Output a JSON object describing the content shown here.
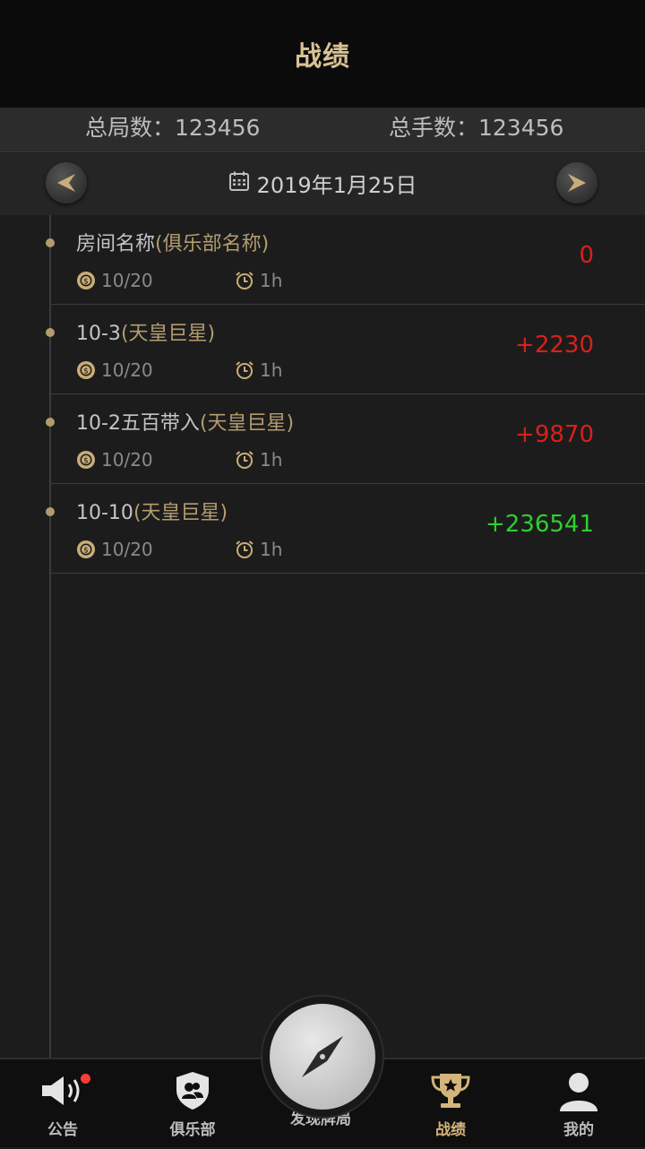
{
  "header": {
    "title": "战绩"
  },
  "stats": {
    "total_rounds": "总局数：123456",
    "total_hands": "总手数：123456"
  },
  "date_bar": {
    "date": "2019年1月25日"
  },
  "records": [
    {
      "room": "房间名称",
      "club": "(俱乐部名称)",
      "blinds": "10/20",
      "duration": "1h",
      "score": "0",
      "score_color": "#d9201a"
    },
    {
      "room": "10-3",
      "club": "(天皇巨星)",
      "blinds": "10/20",
      "duration": "1h",
      "score": "+2230",
      "score_color": "#d9201a"
    },
    {
      "room": "10-2五百带入",
      "club": "(天皇巨星)",
      "blinds": "10/20",
      "duration": "1h",
      "score": "+9870",
      "score_color": "#d9201a"
    },
    {
      "room": "10-10",
      "club": "(天皇巨星)",
      "blinds": "10/20",
      "duration": "1h",
      "score": "+236541",
      "score_color": "#2fcf2f"
    }
  ],
  "tabbar": {
    "items": [
      {
        "label": "公告",
        "icon": "speaker-icon",
        "has_badge": true
      },
      {
        "label": "俱乐部",
        "icon": "club-shield-icon"
      },
      {
        "label": "发现牌局",
        "icon": "compass-icon"
      },
      {
        "label": "战绩",
        "icon": "trophy-icon",
        "active": true
      },
      {
        "label": "我的",
        "icon": "user-icon"
      }
    ]
  },
  "colors": {
    "accent": "#d3b47a",
    "negative_or_zero": "#d9201a",
    "positive_large": "#2fcf2f"
  }
}
